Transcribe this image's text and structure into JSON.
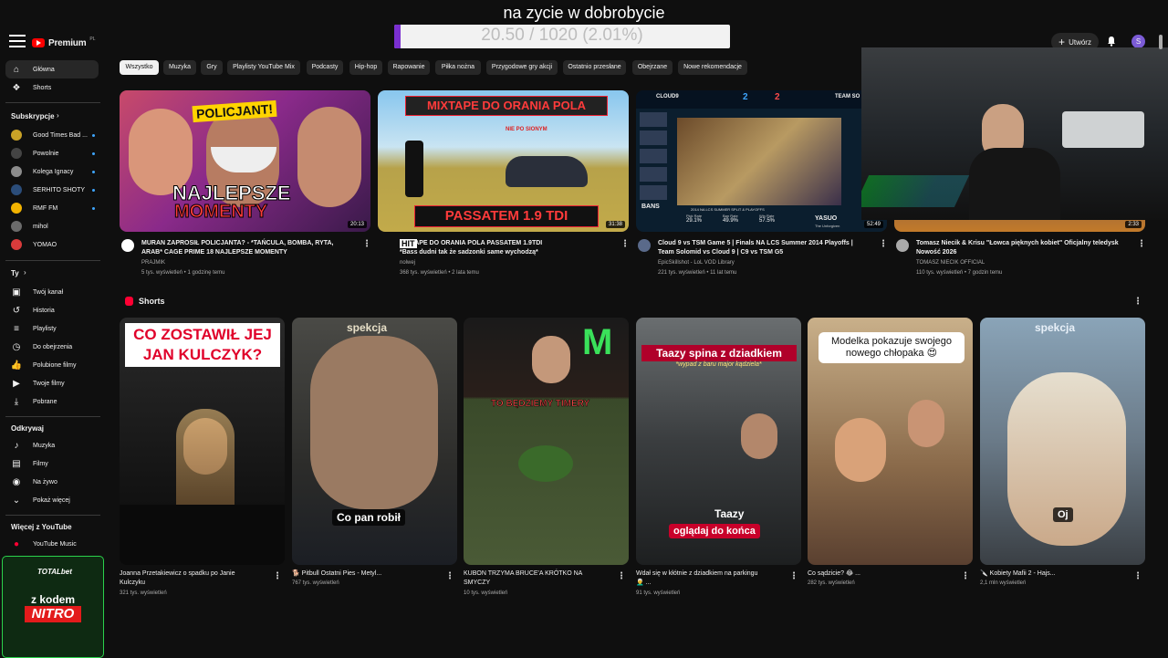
{
  "overlay": {
    "title": "na zycie w dobrobycie",
    "goal_text": "20.50 / 1020 (2.01%)",
    "goal_fraction": 0.0201,
    "goal_color": "#7a2fd0"
  },
  "masthead": {
    "logo_text": "Premium",
    "logo_sup": "PL",
    "create_label": "Utwórz",
    "avatar_letter": "S"
  },
  "sidebar": {
    "main": [
      {
        "label": "Główna",
        "icon": "home-icon"
      },
      {
        "label": "Shorts",
        "icon": "shorts-icon"
      }
    ],
    "subs_header": "Subskrypcje",
    "subs": [
      {
        "label": "Good Times Bad ...",
        "color": "#c9a227",
        "dot": true
      },
      {
        "label": "Powolnie",
        "color": "#444444",
        "dot": true
      },
      {
        "label": "Kolega Ignacy",
        "color": "#8c8c8c",
        "dot": true
      },
      {
        "label": "SERHITO SHOTY",
        "color": "#2b4d7a",
        "dot": true
      },
      {
        "label": "RMF FM",
        "color": "#f2b300",
        "dot": true
      },
      {
        "label": "mihol",
        "color": "#6b6b6b",
        "dot": false
      },
      {
        "label": "YOMAO",
        "color": "#d93b3b",
        "dot": false
      }
    ],
    "you_header": "Ty",
    "you": [
      {
        "label": "Twój kanał",
        "icon": "channel-icon"
      },
      {
        "label": "Historia",
        "icon": "history-icon"
      },
      {
        "label": "Playlisty",
        "icon": "playlist-icon"
      },
      {
        "label": "Do obejrzenia",
        "icon": "watch-later-icon"
      },
      {
        "label": "Polubione filmy",
        "icon": "like-icon"
      },
      {
        "label": "Twoje filmy",
        "icon": "your-videos-icon"
      },
      {
        "label": "Pobrane",
        "icon": "download-icon"
      }
    ],
    "explore_header": "Odkrywaj",
    "explore": [
      {
        "label": "Muzyka",
        "icon": "music-icon"
      },
      {
        "label": "Filmy",
        "icon": "film-icon"
      },
      {
        "label": "Na żywo",
        "icon": "live-icon"
      },
      {
        "label": "Pokaż więcej",
        "icon": "chevron-down-icon"
      }
    ],
    "more_header": "Więcej z YouTube",
    "more": [
      {
        "label": "YouTube Music",
        "icon": "youtube-music-icon"
      }
    ]
  },
  "promo": {
    "brand": "TOTALbet",
    "line1": "z kodem",
    "line2": "NITRO"
  },
  "chips": [
    "Wszystko",
    "Muzyka",
    "Gry",
    "Playlisty YouTube Mix",
    "Podcasty",
    "Hip-hop",
    "Rapowanie",
    "Piłka nożna",
    "Przygodowe gry akcji",
    "Ostatnio przesłane",
    "Obejrzane",
    "Nowe rekomendacje"
  ],
  "videos": [
    {
      "title_line1": "MURAN ZAPROSIŁ POLICJANTA? - *TAŃCULA, BOMBA, RYTA,",
      "title_line2": "ARAB* CAGE PRIME 18 NAJLEPSZE MOMENTY",
      "channel": "PRAJMIK",
      "meta": "5 tys. wyświetleń • 1 godzinę temu",
      "duration": "20:13",
      "thumb_top": "POLICJANT!",
      "thumb_main": "NAJLEPSZE",
      "thumb_sub": "MOMENTY"
    },
    {
      "title_line1": "MIXTAPE DO ORANIA POLA PASSATEM 1.9TDI",
      "title_line2": "*Bass dudni tak że sadzonki same wychodzą*",
      "channel": "nolwej",
      "meta": "368 tys. wyświetleń • 2 lata temu",
      "duration": "31:38",
      "badge": "HIT",
      "thumb_top": "MIXTAPE DO ORANIA POLA",
      "thumb_small": "NIE PO SIONYM",
      "thumb_bottom": "PASSATEM 1.9 TDI"
    },
    {
      "title_line1": "Cloud 9 vs TSM Game 5 | Finals NA LCS Summer 2014 Playoffs |",
      "title_line2": "Team Solomid vs Cloud 9 | C9 vs TSM G5",
      "channel": "EpicSkillshot - LoL VOD Library",
      "meta": "221 tys. wyświetleń • 11 lat temu",
      "duration": "52:49",
      "score_left": "2",
      "score_right": "2",
      "team_left": "CLOUD9",
      "team_right": "TEAM SO",
      "bans": "BANS",
      "champ": "YASUO",
      "champ_sub": "The Unforgiven",
      "lcs": "2014 NA LCS SUMMER SPLIT & PLAYOFFS",
      "stat1": "Pick Rate",
      "stat1v": "29.1%",
      "stat2": "Ban Rate",
      "stat2v": "49.9%",
      "stat3": "Win Rate",
      "stat3v": "57.5%"
    },
    {
      "title_line1": "Tomasz Niecik & Krisu \"Łowca pięknych kobiet\" Oficjalny teledysk",
      "title_line2": "Nowość 2026",
      "channel": "TOMASZ NIECIK OFFICIAL",
      "meta": "110 tys. wyświetleń • 7 godzin temu",
      "duration": "2:33"
    }
  ],
  "shorts_header": "Shorts",
  "shorts": [
    {
      "title_line1": "Joanna Przetakiewicz o spadku po Janie",
      "title_line2": "Kulczyku",
      "views": "321 tys. wyświetleń",
      "overlay": "CO ZOSTAWIŁ JEJ JAN KULCZYK?"
    },
    {
      "title_line1": "🐕 Pitbull Ostatni Pies - Metyl...",
      "title_line2": "",
      "views": "767 tys. wyświetleń",
      "overlay": "spekcja",
      "caption": "Co pan robił"
    },
    {
      "title_line1": "KUBON TRZYMA BRUCE'A KRÓTKO NA",
      "title_line2": "SMYCZY",
      "views": "10 tys. wyświetleń",
      "overlay": "TO BĘDZIEMY TIMERY"
    },
    {
      "title_line1": "Wdał się w kłótnie z dziadkiem na parkingu",
      "title_line2": "👨‍🦳 ...",
      "views": "91 tys. wyświetleń",
      "overlay": "Taazy spina z dziadkiem",
      "overlay_sub": "*wypad z baru major kądziela*",
      "caption": "Taazy",
      "caption2": "oglądaj do końca"
    },
    {
      "title_line1": "Co sądzicie? 😂 ...",
      "title_line2": "",
      "views": "282 tys. wyświetleń",
      "overlay": "Modelka pokazuje swojego nowego chłopaka 😍"
    },
    {
      "title_line1": "🔪 Kobiety Mafii 2 - Hajs...",
      "title_line2": "",
      "views": "2,1 mln wyświetleń",
      "overlay": "spekcja",
      "caption": "Oj"
    }
  ]
}
